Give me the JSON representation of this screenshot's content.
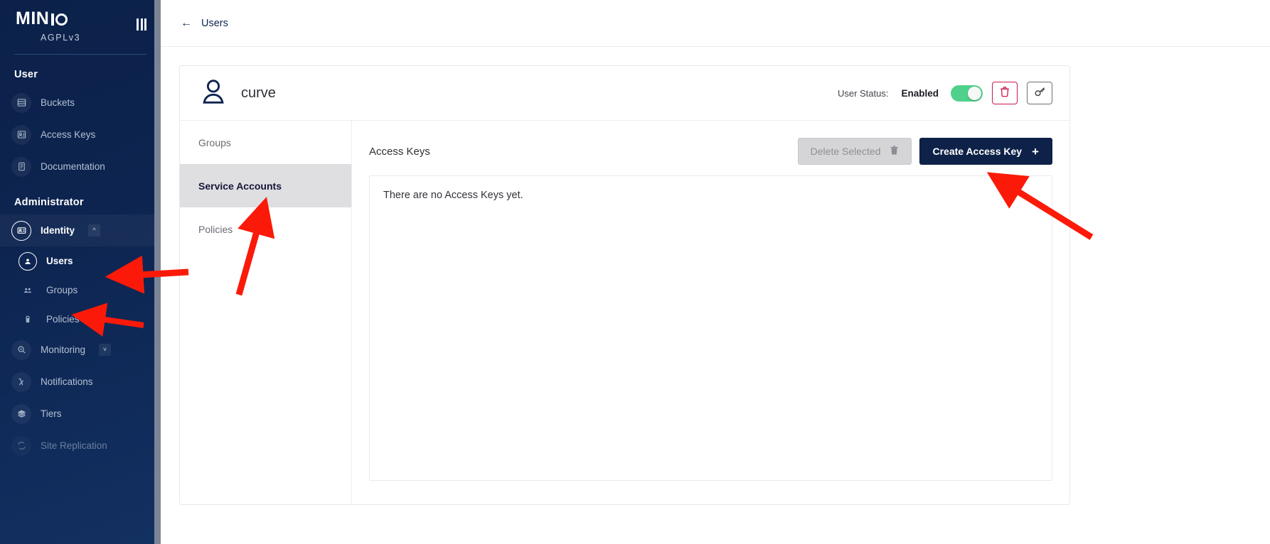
{
  "sidebar": {
    "logo_text": "MINIO",
    "logo_license": "AGPLv3",
    "collapse_icon": "menu-bars-icon",
    "sections": [
      {
        "title": "User",
        "items": [
          {
            "label": "Buckets",
            "icon": "buckets-icon"
          },
          {
            "label": "Access Keys",
            "icon": "access-keys-icon"
          },
          {
            "label": "Documentation",
            "icon": "documentation-icon"
          }
        ]
      },
      {
        "title": "Administrator",
        "items": [
          {
            "label": "Identity",
            "icon": "identity-icon",
            "expanded": true,
            "chevron": "chevron-up-icon"
          },
          {
            "label": "Monitoring",
            "icon": "monitoring-icon",
            "expanded": false,
            "chevron": "chevron-down-icon"
          },
          {
            "label": "Notifications",
            "icon": "notifications-lambda-icon"
          },
          {
            "label": "Tiers",
            "icon": "tiers-layers-icon"
          },
          {
            "label": "Site Replication",
            "icon": "site-replication-icon"
          }
        ]
      }
    ],
    "identity_children": [
      {
        "label": "Users",
        "icon": "user-circle-icon",
        "active": true
      },
      {
        "label": "Groups",
        "icon": "groups-icon",
        "active": false
      },
      {
        "label": "Policies",
        "icon": "policies-lock-icon",
        "active": false
      }
    ]
  },
  "topbar": {
    "back_icon": "arrow-left-icon",
    "breadcrumb": "Users"
  },
  "user_card": {
    "avatar_icon": "user-avatar-icon",
    "username": "curve",
    "status_label": "User Status:",
    "status_value": "Enabled",
    "toggle_on": true,
    "delete_button_icon": "trash-icon",
    "key_button_icon": "key-icon"
  },
  "tabs": [
    {
      "label": "Groups",
      "active": false
    },
    {
      "label": "Service Accounts",
      "active": true
    },
    {
      "label": "Policies",
      "active": false
    }
  ],
  "panel": {
    "title": "Access Keys",
    "delete_selected_label": "Delete Selected",
    "delete_selected_icon": "trash-icon",
    "create_label": "Create Access Key",
    "create_icon": "plus-icon",
    "empty_message": "There are no Access Keys yet."
  },
  "colors": {
    "sidebar_bg": "#0d2450",
    "primary": "#0e2148",
    "toggle_on": "#4fd18b",
    "danger": "#c9184a",
    "annotation": "#fb1a09"
  }
}
